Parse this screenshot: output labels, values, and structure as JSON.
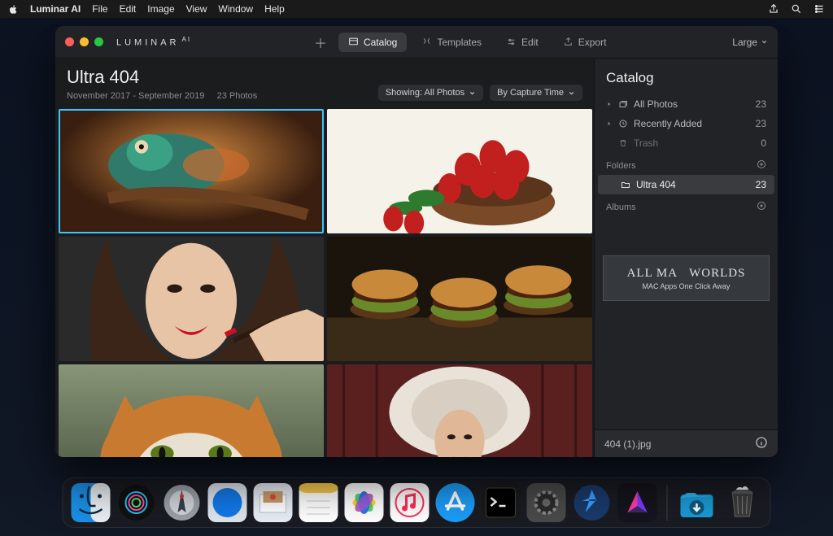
{
  "menubar": {
    "app_name": "Luminar AI",
    "items": [
      "File",
      "Edit",
      "Image",
      "View",
      "Window",
      "Help"
    ]
  },
  "window": {
    "wordmark": "LUMINAR",
    "wordmark_sup": "AI",
    "nav": {
      "catalog": "Catalog",
      "templates": "Templates",
      "edit": "Edit",
      "export": "Export"
    },
    "size_selector": "Large"
  },
  "main": {
    "title": "Ultra 404",
    "subtitle_range": "November 2017 - September 2019",
    "subtitle_count": "23 Photos",
    "filter_showing": "Showing: All Photos",
    "filter_sort": "By Capture Time",
    "thumbs": [
      {
        "name": "chameleon",
        "selected": true
      },
      {
        "name": "strawberries",
        "selected": false
      },
      {
        "name": "woman-lipstick",
        "selected": false
      },
      {
        "name": "burgers",
        "selected": false
      },
      {
        "name": "cat",
        "selected": false
      },
      {
        "name": "woman-fur-hat",
        "selected": false
      }
    ]
  },
  "sidebar": {
    "title": "Catalog",
    "items": {
      "all_photos": {
        "label": "All Photos",
        "count": "23"
      },
      "recently_added": {
        "label": "Recently Added",
        "count": "23"
      },
      "trash": {
        "label": "Trash",
        "count": "0"
      }
    },
    "folders_header": "Folders",
    "folder": {
      "label": "Ultra 404",
      "count": "23"
    },
    "albums_header": "Albums",
    "watermark_line1": "ALL MA   WORLDS",
    "watermark_line2": "MAC Apps One Click Away",
    "footer_filename": "404 (1).jpg"
  },
  "dock": {
    "apps": [
      "finder",
      "siri",
      "launchpad",
      "safari",
      "mail",
      "notes",
      "photos",
      "music",
      "appstore",
      "terminal",
      "systemprefs",
      "extra-circle",
      "luminar"
    ],
    "right": [
      "downloads",
      "trash"
    ]
  }
}
